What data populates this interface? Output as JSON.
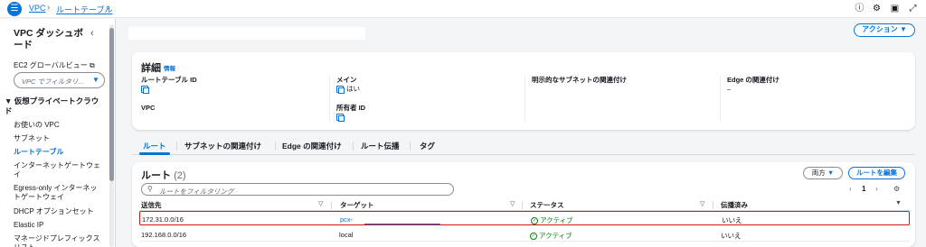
{
  "breadcrumb": {
    "vpc": "VPC",
    "route_tables": "ルートテーブル"
  },
  "sidebar": {
    "title": "VPC ダッシュボード",
    "ec2_global_view": "EC2 グローバルビュー",
    "filter_placeholder": "VPC でフィルタリ...",
    "section": "仮想プライベートクラウド",
    "items": [
      {
        "label": "お使いの VPC"
      },
      {
        "label": "サブネット"
      },
      {
        "label": "ルートテーブル"
      },
      {
        "label": "インターネットゲートウェイ"
      },
      {
        "label": "Egress-only インターネットゲートウェイ"
      },
      {
        "label": "DHCP オプションセット"
      },
      {
        "label": "Elastic IP"
      },
      {
        "label": "マネージドプレフィックスリスト"
      }
    ]
  },
  "actions_label": "アクション",
  "details": {
    "title": "詳細",
    "info": "情報",
    "route_table_id_label": "ルートテーブル ID",
    "main_label": "メイン",
    "main_value": "はい",
    "explicit_subnet_label": "明示的なサブネットの関連付け",
    "edge_assoc_label": "Edge の関連付け",
    "edge_assoc_value": "–",
    "vpc_label": "VPC",
    "owner_id_label": "所有者 ID"
  },
  "tabs": [
    {
      "label": "ルート"
    },
    {
      "label": "サブネットの関連付け"
    },
    {
      "label": "Edge の関連付け"
    },
    {
      "label": "ルート伝播"
    },
    {
      "label": "タグ"
    }
  ],
  "routes": {
    "title": "ルート",
    "count": "(2)",
    "both_label": "両方",
    "edit_label": "ルートを編集",
    "filter_placeholder": "ルートをフィルタリング",
    "page": "1",
    "columns": [
      "送信先",
      "ターゲット",
      "ステータス",
      "伝播済み"
    ],
    "rows": [
      {
        "destination": "172.31.0.0/16",
        "target": "pcx-",
        "status": "アクティブ",
        "propagated": "いいえ"
      },
      {
        "destination": "192.168.0.0/16",
        "target": "local",
        "status": "アクティブ",
        "propagated": "いいえ"
      }
    ]
  },
  "colors": {
    "accent": "#0972d3",
    "success": "#037f0c",
    "highlight": "#d91515"
  }
}
